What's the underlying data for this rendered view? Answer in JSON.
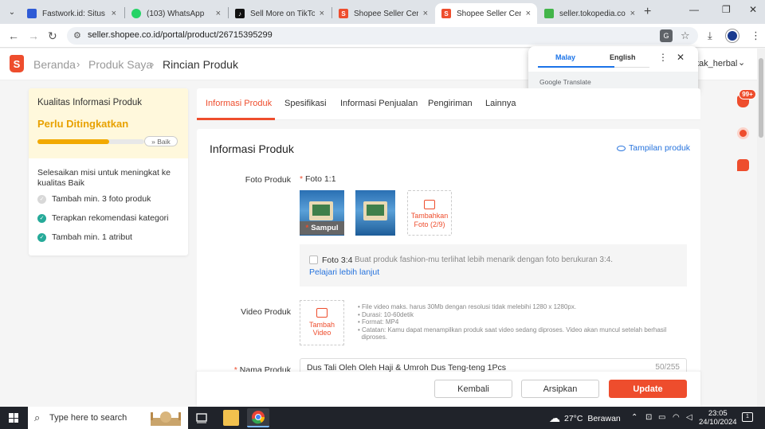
{
  "browser": {
    "tabs": [
      {
        "title": "Fastwork.id: Situs Free",
        "favicon_color": "#2f5bd6",
        "icon": "fastwork-icon"
      },
      {
        "title": "(103) WhatsApp",
        "favicon_color": "#25d366",
        "icon": "whatsapp-icon"
      },
      {
        "title": "Sell More on TikTok S",
        "favicon_color": "#111111",
        "icon": "tiktok-icon"
      },
      {
        "title": "Shopee Seller Centre",
        "favicon_color": "#ee4d2d",
        "icon": "shopee-icon"
      },
      {
        "title": "Shopee Seller Centre",
        "favicon_color": "#ee4d2d",
        "icon": "shopee-icon"
      },
      {
        "title": "seller.tokopedia.com",
        "favicon_color": "#42b549",
        "icon": "tokopedia-icon"
      }
    ],
    "active_tab_index": 4,
    "url": "seller.shopee.co.id/portal/product/26715395299"
  },
  "translate_popup": {
    "source_lang": "Malay",
    "target_lang": "English",
    "brand_google": "Google",
    "brand_translate": "Translate"
  },
  "header": {
    "breadcrumb": [
      "Beranda",
      "Produk Saya",
      "Rincian Produk"
    ],
    "shop_name": "tak_herbal"
  },
  "quality_panel": {
    "title": "Kualitas Informasi Produk",
    "status": "Perlu Ditingkatkan",
    "progress": 0.67,
    "next_level": "Baik",
    "mission_title": "Selesaikan misi untuk meningkat ke kualitas Baik",
    "missions": [
      {
        "label": "Tambah min. 3 foto produk",
        "done": false
      },
      {
        "label": "Terapkan rekomendasi kategori",
        "done": true
      },
      {
        "label": "Tambah min. 1 atribut",
        "done": true
      }
    ]
  },
  "product_tabs": [
    "Informasi Produk",
    "Spesifikasi",
    "Informasi Penjualan",
    "Pengiriman",
    "Lainnya"
  ],
  "active_product_tab": 0,
  "form": {
    "section_title": "Informasi Produk",
    "preview_link": "Tampilan produk",
    "photo_label": "Foto Produk",
    "photo_ratio_label": "Foto 1:1",
    "cover_label": "Sampul",
    "add_photo_line1": "Tambahkan",
    "add_photo_line2": "Foto (2/9)",
    "ratio34_label": "Foto 3:4",
    "ratio34_hint": "Buat produk fashion-mu terlihat lebih menarik dengan foto berukuran 3:4.",
    "ratio34_link": "Pelajari lebih lanjut",
    "video_label": "Video Produk",
    "add_video_line1": "Tambah",
    "add_video_line2": "Video",
    "video_notes": [
      "File video maks. harus 30Mb dengan resolusi tidak melebihi 1280 x 1280px.",
      "Durasi: 10-60detik",
      "Format: MP4",
      "Catatan: Kamu dapat menampilkan produk saat video sedang diproses. Video akan muncul setelah berhasil",
      "diproses."
    ],
    "name_label": "Nama Produk",
    "name_value": "Dus Tali Oleh Oleh Haji & Umroh Dus Teng-teng 1Pcs",
    "name_count": "50/255"
  },
  "actions": {
    "back": "Kembali",
    "archive": "Arsipkan",
    "update": "Update"
  },
  "notifications": {
    "badge": "99+"
  },
  "taskbar": {
    "search_placeholder": "Type here to search",
    "weather_temp": "27°C",
    "weather_desc": "Berawan",
    "time": "23:05",
    "date": "24/10/2024",
    "notif_count": "1"
  },
  "colors": {
    "brand": "#ee4d2d",
    "link": "#2673dd",
    "warning": "#e8a100",
    "success": "#26aa99"
  }
}
